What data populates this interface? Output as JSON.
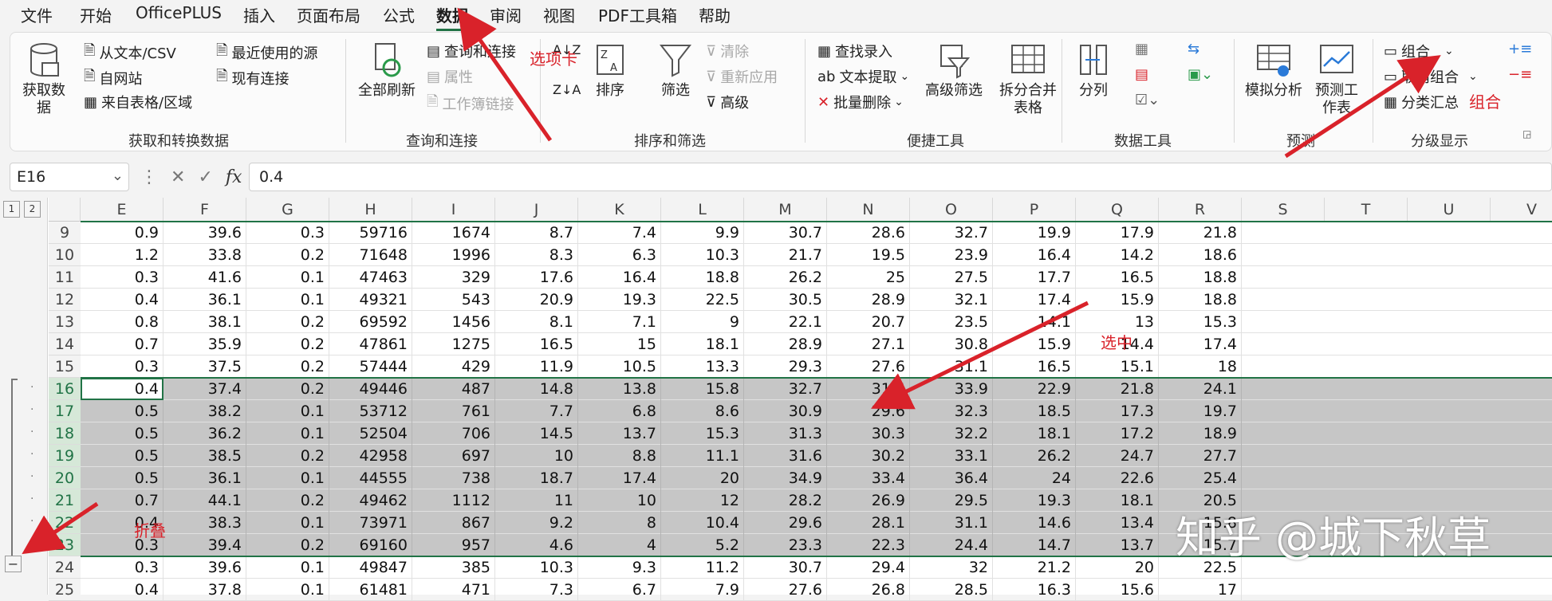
{
  "menu": {
    "items": [
      "文件",
      "开始",
      "OfficePLUS",
      "插入",
      "页面布局",
      "公式",
      "数据",
      "审阅",
      "视图",
      "PDF工具箱",
      "帮助"
    ],
    "active": "数据"
  },
  "ribbon": {
    "get_data": {
      "big": "获取数据",
      "from_text": "从文本/CSV",
      "from_web": "自网站",
      "from_table": "来自表格/区域",
      "recent_sources": "最近使用的源",
      "existing_conn": "现有连接",
      "group": "获取和转换数据"
    },
    "queries": {
      "refresh_all": "全部刷新",
      "queries_conn": "查询和连接",
      "properties": "属性",
      "edit_links": "工作簿链接",
      "group": "查询和连接"
    },
    "sort_filter": {
      "sort": "排序",
      "filter": "筛选",
      "clear": "清除",
      "reapply": "重新应用",
      "advanced": "高级",
      "group": "排序和筛选"
    },
    "quick": {
      "find_enter": "查找录入",
      "text_extract": "文本提取",
      "bulk_delete": "批量删除",
      "adv_filter": "高级筛选",
      "split_merge": "拆分合并表格",
      "group": "便捷工具"
    },
    "data_tools": {
      "text_to_cols": "分列",
      "group": "数据工具"
    },
    "forecast": {
      "what_if": "模拟分析",
      "sheet": "预测工作表",
      "group": "预测"
    },
    "outline": {
      "group_btn": "组合",
      "ungroup": "取消组合",
      "subtotal": "分类汇总",
      "group": "分级显示"
    }
  },
  "formula": {
    "namebox": "E16",
    "value": "0.4",
    "fx": "fx"
  },
  "outline_levels": [
    "1",
    "2"
  ],
  "collapse_btn": "−",
  "columns": [
    "E",
    "F",
    "G",
    "H",
    "I",
    "J",
    "K",
    "L",
    "M",
    "N",
    "O",
    "P",
    "Q",
    "R",
    "S",
    "T",
    "U",
    "V"
  ],
  "rows": [
    {
      "n": "9",
      "v": [
        "0.9",
        "39.6",
        "0.3",
        "59716",
        "1674",
        "8.7",
        "7.4",
        "9.9",
        "30.7",
        "28.6",
        "32.7",
        "19.9",
        "17.9",
        "21.8"
      ]
    },
    {
      "n": "10",
      "v": [
        "1.2",
        "33.8",
        "0.2",
        "71648",
        "1996",
        "8.3",
        "6.3",
        "10.3",
        "21.7",
        "19.5",
        "23.9",
        "16.4",
        "14.2",
        "18.6"
      ]
    },
    {
      "n": "11",
      "v": [
        "0.3",
        "41.6",
        "0.1",
        "47463",
        "329",
        "17.6",
        "16.4",
        "18.8",
        "26.2",
        "25",
        "27.5",
        "17.7",
        "16.5",
        "18.8"
      ]
    },
    {
      "n": "12",
      "v": [
        "0.4",
        "36.1",
        "0.1",
        "49321",
        "543",
        "20.9",
        "19.3",
        "22.5",
        "30.5",
        "28.9",
        "32.1",
        "17.4",
        "15.9",
        "18.8"
      ]
    },
    {
      "n": "13",
      "v": [
        "0.8",
        "38.1",
        "0.2",
        "69592",
        "1456",
        "8.1",
        "7.1",
        "9",
        "22.1",
        "20.7",
        "23.5",
        "14.1",
        "13",
        "15.3"
      ]
    },
    {
      "n": "14",
      "v": [
        "0.7",
        "35.9",
        "0.2",
        "47861",
        "1275",
        "16.5",
        "15",
        "18.1",
        "28.9",
        "27.1",
        "30.8",
        "15.9",
        "14.4",
        "17.4"
      ]
    },
    {
      "n": "15",
      "v": [
        "0.3",
        "37.5",
        "0.2",
        "57444",
        "429",
        "11.9",
        "10.5",
        "13.3",
        "29.3",
        "27.6",
        "31.1",
        "16.5",
        "15.1",
        "18"
      ]
    },
    {
      "n": "16",
      "v": [
        "0.4",
        "37.4",
        "0.2",
        "49446",
        "487",
        "14.8",
        "13.8",
        "15.8",
        "32.7",
        "31.5",
        "33.9",
        "22.9",
        "21.8",
        "24.1"
      ]
    },
    {
      "n": "17",
      "v": [
        "0.5",
        "38.2",
        "0.1",
        "53712",
        "761",
        "7.7",
        "6.8",
        "8.6",
        "30.9",
        "29.6",
        "32.3",
        "18.5",
        "17.3",
        "19.7"
      ]
    },
    {
      "n": "18",
      "v": [
        "0.5",
        "36.2",
        "0.1",
        "52504",
        "706",
        "14.5",
        "13.7",
        "15.3",
        "31.3",
        "30.3",
        "32.2",
        "18.1",
        "17.2",
        "18.9"
      ]
    },
    {
      "n": "19",
      "v": [
        "0.5",
        "38.5",
        "0.2",
        "42958",
        "697",
        "10",
        "8.8",
        "11.1",
        "31.6",
        "30.2",
        "33.1",
        "26.2",
        "24.7",
        "27.7"
      ]
    },
    {
      "n": "20",
      "v": [
        "0.5",
        "36.1",
        "0.1",
        "44555",
        "738",
        "18.7",
        "17.4",
        "20",
        "34.9",
        "33.4",
        "36.4",
        "24",
        "22.6",
        "25.4"
      ]
    },
    {
      "n": "21",
      "v": [
        "0.7",
        "44.1",
        "0.2",
        "49462",
        "1112",
        "11",
        "10",
        "12",
        "28.2",
        "26.9",
        "29.5",
        "19.3",
        "18.1",
        "20.5"
      ]
    },
    {
      "n": "22",
      "v": [
        "0.4",
        "38.3",
        "0.1",
        "73971",
        "867",
        "9.2",
        "8",
        "10.4",
        "29.6",
        "28.1",
        "31.1",
        "14.6",
        "13.4",
        "15.8"
      ]
    },
    {
      "n": "23",
      "v": [
        "0.3",
        "39.4",
        "0.2",
        "69160",
        "957",
        "4.6",
        "4",
        "5.2",
        "23.3",
        "22.3",
        "24.4",
        "14.7",
        "13.7",
        "15.7"
      ]
    },
    {
      "n": "24",
      "v": [
        "0.3",
        "39.6",
        "0.1",
        "49847",
        "385",
        "10.3",
        "9.3",
        "11.2",
        "30.7",
        "29.4",
        "32",
        "21.2",
        "20",
        "22.5"
      ]
    },
    {
      "n": "25",
      "v": [
        "0.4",
        "37.8",
        "0.1",
        "61481",
        "471",
        "7.3",
        "6.7",
        "7.9",
        "27.6",
        "26.8",
        "28.5",
        "16.3",
        "15.6",
        "17"
      ]
    }
  ],
  "annotations": {
    "tab_note": "选项卡",
    "group_note": "组合",
    "select_note": "选中",
    "collapse_note": "折叠",
    "arrow_color": "#d9222a"
  },
  "watermark": "知乎 @城下秋草",
  "colors": {
    "accent": "#217346",
    "selection": "#c6c6c6"
  }
}
